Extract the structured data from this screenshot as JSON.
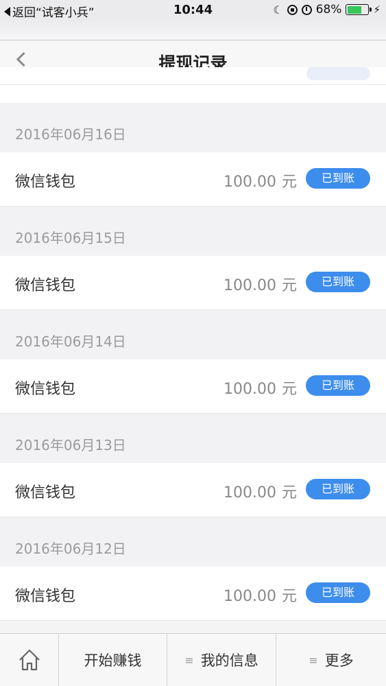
{
  "status_bar": {
    "back_label": "返回“试客小兵”",
    "time": "10:44",
    "battery_percent_text": "68%",
    "battery_level": 0.68,
    "battery_color": "#35c759"
  },
  "header": {
    "title": "提现记录",
    "back_icon": "chevron-left-icon"
  },
  "records": [
    {
      "date": "2016年06月16日",
      "name": "微信钱包",
      "amount": "100.00",
      "unit": "元",
      "status": "已到账"
    },
    {
      "date": "2016年06月15日",
      "name": "微信钱包",
      "amount": "100.00",
      "unit": "元",
      "status": "已到账"
    },
    {
      "date": "2016年06月14日",
      "name": "微信钱包",
      "amount": "100.00",
      "unit": "元",
      "status": "已到账"
    },
    {
      "date": "2016年06月13日",
      "name": "微信钱包",
      "amount": "100.00",
      "unit": "元",
      "status": "已到账"
    },
    {
      "date": "2016年06月12日",
      "name": "微信钱包",
      "amount": "100.00",
      "unit": "元",
      "status": "已到账"
    }
  ],
  "tab_bar": {
    "home_icon": "home-icon",
    "earn": "开始赚钱",
    "info": "我的信息",
    "more": "更多",
    "menu_glyph": "≡"
  },
  "colors": {
    "status_pill": "#3d8ded",
    "background": "#f4f4f5"
  }
}
